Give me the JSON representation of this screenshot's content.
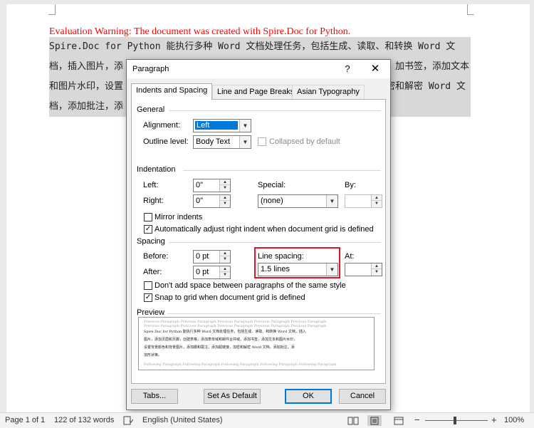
{
  "document": {
    "evaluation_warning": "Evaluation Warning: The document was created with Spire.Doc for Python.",
    "lines": [
      "Spire.Doc for Python 能执行多种 Word 文档处理任务，包括生成、读取、和转换 Word 文",
      "档，插入图片，添",
      "和图片水印，设置",
      "档，添加批注，添"
    ],
    "lines_right": [
      "",
      "加书签，添加文本",
      "密和解密 Word 文",
      ""
    ]
  },
  "dialog": {
    "title": "Paragraph",
    "help_label": "?",
    "close_label": "✕",
    "tabs": [
      {
        "label": "Indents and Spacing",
        "active": true
      },
      {
        "label": "Line and Page Breaks",
        "active": false
      },
      {
        "label": "Asian Typography",
        "active": false
      }
    ],
    "general": {
      "heading": "General",
      "alignment_label": "Alignment:",
      "alignment_value": "Left",
      "outline_label": "Outline level:",
      "outline_value": "Body Text",
      "collapsed_label": "Collapsed by default"
    },
    "indentation": {
      "heading": "Indentation",
      "left_label": "Left:",
      "left_value": "0\"",
      "right_label": "Right:",
      "right_value": "0\"",
      "special_label": "Special:",
      "special_value": "(none)",
      "by_label": "By:",
      "by_value": "",
      "mirror_label": "Mirror indents",
      "mirror_checked": false,
      "auto_adjust_label": "Automatically adjust right indent when document grid is defined",
      "auto_adjust_checked": true
    },
    "spacing": {
      "heading": "Spacing",
      "before_label": "Before:",
      "before_value": "0 pt",
      "after_label": "After:",
      "after_value": "0 pt",
      "line_spacing_label": "Line spacing:",
      "line_spacing_value": "1.5 lines",
      "at_label": "At:",
      "at_value": "",
      "dont_add_label": "Don't add space between paragraphs of the same style",
      "dont_add_checked": false,
      "snap_label": "Snap to grid when document grid is defined",
      "snap_checked": true
    },
    "preview": {
      "heading": "Preview",
      "prev_text": "Previous Paragraph Previous Paragraph Previous Paragraph Previous Paragraph Previous Paragraph",
      "prev_text2": "Previous Paragraph Previous Paragraph Previous Paragraph Previous Paragraph Previous Paragraph",
      "main_lines": [
        "Spire.Doc for Python 能执行多种 Word 文档处理任务，包括生成、读取、和转换 Word 文档，插入",
        "图片，添加页眉和页脚，创建表格，添加表单域和邮件合并域，添加书签，添加文本和图片水印，",
        "设置背景颜色和背景图片，添加脚和尾注，添加超链接，加密和解密 Word 文档，添加批注，添",
        "加形状等。"
      ],
      "next_text": "Following Paragraph Following Paragraph Following Paragraph Following Paragraph Following Paragraph"
    },
    "buttons": {
      "tabs": "Tabs...",
      "set_default": "Set As Default",
      "ok": "OK",
      "cancel": "Cancel"
    }
  },
  "statusbar": {
    "page": "Page 1 of 1",
    "words": "122 of 132 words",
    "language": "English (United States)",
    "zoom": "100%",
    "zoom_minus": "−",
    "zoom_plus": "+"
  }
}
